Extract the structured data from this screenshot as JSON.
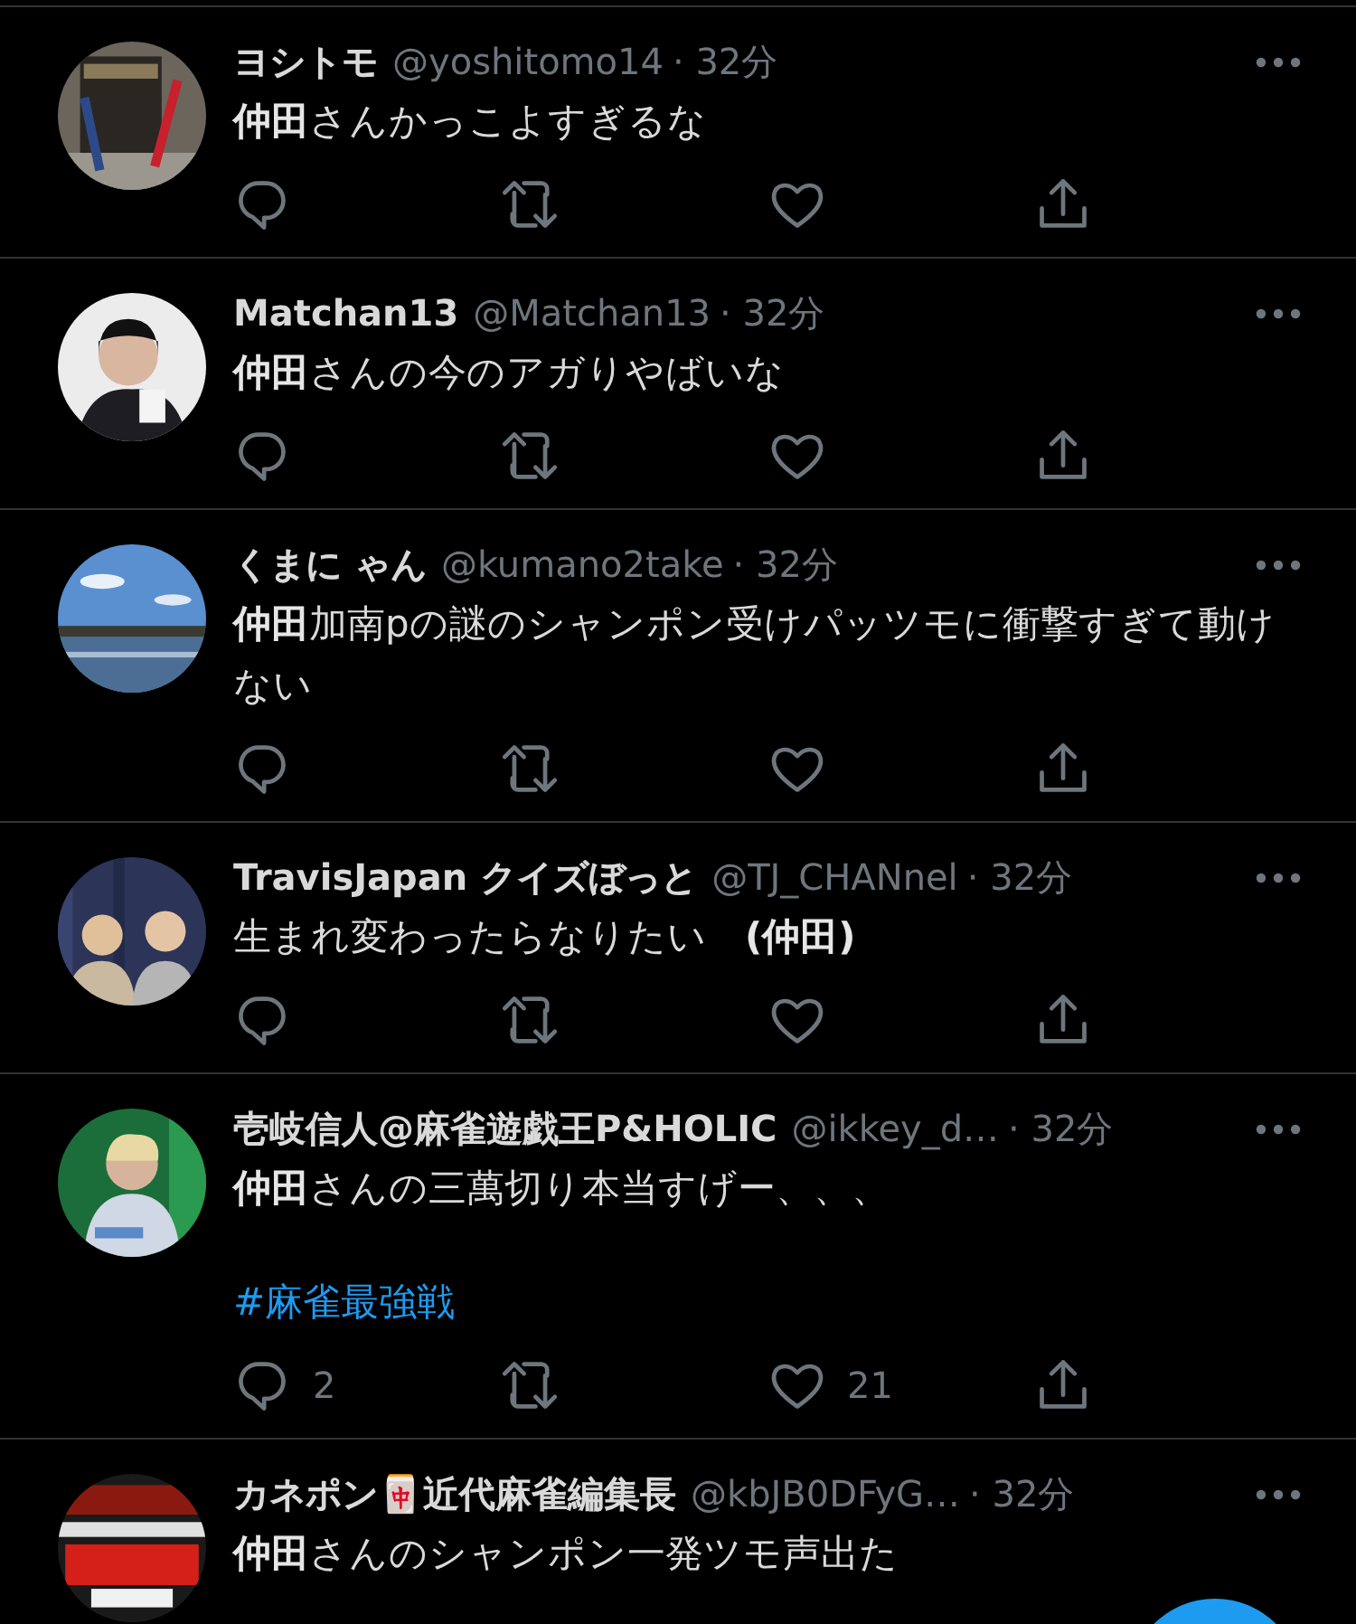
{
  "tweets": [
    {
      "name": "ヨシトモ",
      "handle": "@yoshitomo14",
      "time": "· 32分",
      "text": "**仲田**さんかっこよすぎるな",
      "actions": [
        {
          "kind": "reply"
        },
        {
          "kind": "retweet"
        },
        {
          "kind": "like"
        },
        {
          "kind": "share"
        }
      ]
    },
    {
      "name": "Matchan13",
      "handle": "@Matchan13",
      "time": "· 32分",
      "text": "**仲田**さんの今のアガりやばいな",
      "actions": [
        {
          "kind": "reply"
        },
        {
          "kind": "retweet"
        },
        {
          "kind": "like"
        },
        {
          "kind": "share"
        }
      ]
    },
    {
      "name": "くまに ゃん",
      "handle": "@kumano2take",
      "time": "· 32分",
      "text": "**仲田**加南pの謎のシャンポン受けパッツモに衝撃すぎて動けない",
      "actions": [
        {
          "kind": "reply"
        },
        {
          "kind": "retweet"
        },
        {
          "kind": "like"
        },
        {
          "kind": "share"
        }
      ]
    },
    {
      "name": "TravisJapan クイズぼっと",
      "handle": "@TJ_CHANnel",
      "time": "· 32分",
      "text": "生まれ変わったらなりたい　**(仲田)**",
      "actions": [
        {
          "kind": "reply"
        },
        {
          "kind": "retweet"
        },
        {
          "kind": "like"
        },
        {
          "kind": "share"
        }
      ]
    },
    {
      "name": "壱岐信人@麻雀遊戯王P&HOLIC",
      "handle": "@ikkey_d…",
      "time": "· 32分",
      "text": "**仲田**さんの三萬切り本当すげー、、、",
      "hashtag": "#麻雀最強戦",
      "actions": [
        {
          "kind": "reply",
          "count": "2"
        },
        {
          "kind": "retweet"
        },
        {
          "kind": "like",
          "count": "21"
        },
        {
          "kind": "share"
        }
      ]
    },
    {
      "name": "カネポン🀄近代麻雀編集長",
      "handle": "@kbJB0DFyG…",
      "time": "· 32分",
      "text": "**仲田**さんのシャンポン一発ツモ声出た"
    }
  ],
  "compose_button": {
    "kind": "fab"
  }
}
